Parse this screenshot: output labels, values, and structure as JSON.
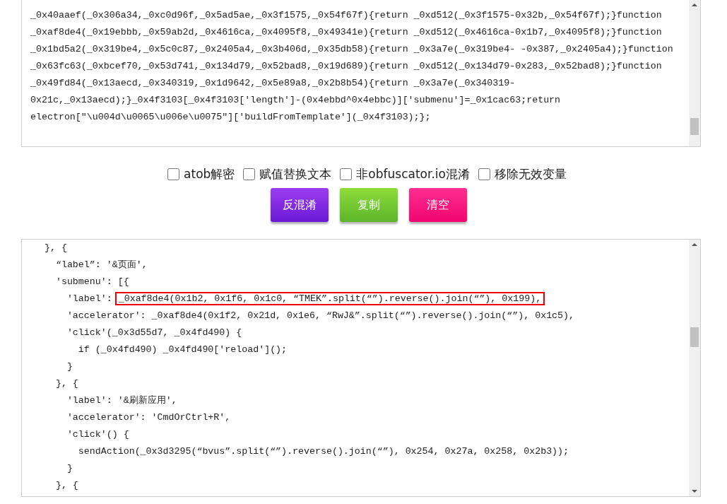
{
  "input_code": {
    "lines": [
      "_0x40aaef(_0x306a34,_0xc0d96f,_0x5ad5ae,_0x3f1575,_0x54f67f){return _0xd512(_0x3f1575-0x32b,_0x54f67f);}function",
      "_0xaf8de4(_0x19ebbb,_0x59ab2d,_0x4616ca,_0x4095f8,_0x49341e){return _0xd512(_0x4616ca-0x1b7,_0x4095f8);}function",
      "_0x1bd5a2(_0x319be4,_0x5c0c87,_0x2405a4,_0x3b406d,_0x35db58){return _0x3a7e(_0x319be4- -0x387,_0x2405a4);}function",
      "_0x63fc63(_0xbcef70,_0x53d741,_0x134d79,_0x52bad8,_0x19d689){return _0xd512(_0x134d79-0x283,_0x52bad8);}function",
      "_0x49fd84(_0x13aecd,_0x340319,_0x1d9642,_0x5e89a8,_0x2b8b54){return _0x3a7e(_0x340319-",
      "0x21c,_0x13aecd);}_0x4f3103[_0x4f3103['length']-(0x4ebbd^0x4ebbc)]['submenu']=_0x1cac63;return",
      "electron[\"\\u004d\\u0065\\u006e\\u0075\"]['buildFromTemplate'](_0x4f3103);};"
    ]
  },
  "options": [
    {
      "label": "atob解密",
      "checked": false
    },
    {
      "label": "赋值替换文本",
      "checked": false
    },
    {
      "label": "非obfuscator.io混淆",
      "checked": false
    },
    {
      "label": "移除无效变量",
      "checked": false
    }
  ],
  "buttons": [
    {
      "label": "反混淆",
      "kind": "deobfuscate"
    },
    {
      "label": "复制",
      "kind": "copy"
    },
    {
      "label": "清空",
      "kind": "clear"
    }
  ],
  "output_code": {
    "lines": [
      {
        "text": "  }, {"
      },
      {
        "text": "    “label”: '&页面',"
      },
      {
        "text": "    'submenu': [{"
      },
      {
        "text": "      'label': ",
        "boxed": "_0xaf8de4(0x1b2, 0x1f6, 0x1c0, “TMEK”.split(“”).reverse().join(“”), 0x199),"
      },
      {
        "text": "      'accelerator': _0xaf8de4(0x1f2, 0x21d, 0x1e6, “RwJ&”.split(“”).reverse().join(“”), 0x1c5),"
      },
      {
        "text": "      'click'(_0x3d55d7, _0x4fd490) {"
      },
      {
        "text": "        if (_0x4fd490) _0x4fd490['reload']();"
      },
      {
        "text": "      }"
      },
      {
        "text": "    }, {"
      },
      {
        "text": "      'label': '&刷新应用',"
      },
      {
        "text": "      'accelerator': 'CmdOrCtrl+R',"
      },
      {
        "text": "      'click'() {"
      },
      {
        "text": "        sendAction(_0x3d3295(“bvus”.split(“”).reverse().join(“”), 0x254, 0x27a, 0x258, 0x2b3));"
      },
      {
        "text": "      }"
      },
      {
        "text": "    }, {"
      }
    ]
  }
}
